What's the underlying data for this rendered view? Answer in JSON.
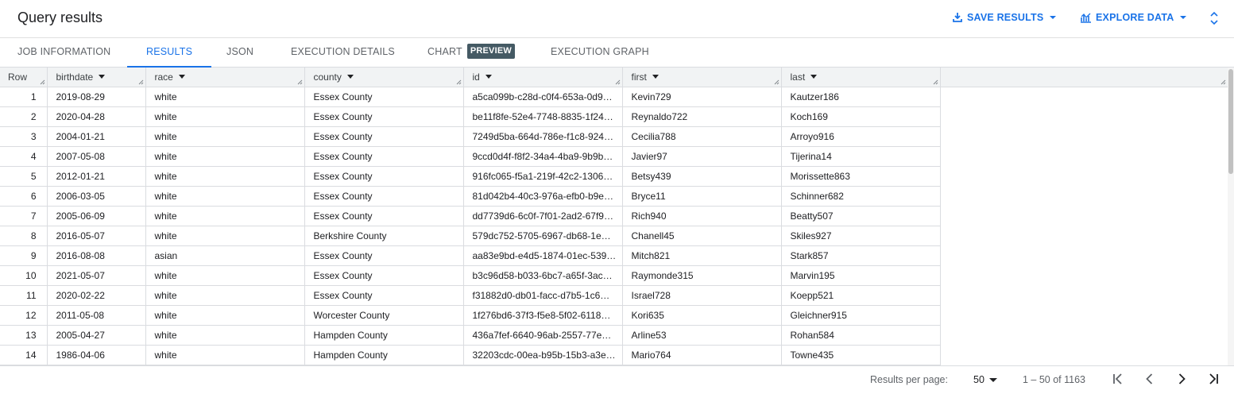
{
  "header": {
    "title": "Query results",
    "save_label": "SAVE RESULTS",
    "explore_label": "EXPLORE DATA"
  },
  "tabs": [
    {
      "label": "JOB INFORMATION"
    },
    {
      "label": "RESULTS"
    },
    {
      "label": "JSON"
    },
    {
      "label": "EXECUTION DETAILS"
    },
    {
      "label": "CHART",
      "badge": "PREVIEW"
    },
    {
      "label": "EXECUTION GRAPH"
    }
  ],
  "active_tab": "RESULTS",
  "table": {
    "row_header": "Row",
    "columns": [
      "birthdate",
      "race",
      "county",
      "id",
      "first",
      "last"
    ],
    "rows": [
      [
        "1",
        "2019-08-29",
        "white",
        "Essex County",
        "a5ca099b-c28d-c0f4-653a-0d9…",
        "Kevin729",
        "Kautzer186"
      ],
      [
        "2",
        "2020-04-28",
        "white",
        "Essex County",
        "be11f8fe-52e4-7748-8835-1f24…",
        "Reynaldo722",
        "Koch169"
      ],
      [
        "3",
        "2004-01-21",
        "white",
        "Essex County",
        "7249d5ba-664d-786e-f1c8-924…",
        "Cecilia788",
        "Arroyo916"
      ],
      [
        "4",
        "2007-05-08",
        "white",
        "Essex County",
        "9ccd0d4f-f8f2-34a4-4ba9-9b9b…",
        "Javier97",
        "Tijerina14"
      ],
      [
        "5",
        "2012-01-21",
        "white",
        "Essex County",
        "916fc065-f5a1-219f-42c2-1306…",
        "Betsy439",
        "Morissette863"
      ],
      [
        "6",
        "2006-03-05",
        "white",
        "Essex County",
        "81d042b4-40c3-976a-efb0-b9e…",
        "Bryce11",
        "Schinner682"
      ],
      [
        "7",
        "2005-06-09",
        "white",
        "Essex County",
        "dd7739d6-6c0f-7f01-2ad2-67f9…",
        "Rich940",
        "Beatty507"
      ],
      [
        "8",
        "2016-05-07",
        "white",
        "Berkshire County",
        "579dc752-5705-6967-db68-1e…",
        "Chanell45",
        "Skiles927"
      ],
      [
        "9",
        "2016-08-08",
        "asian",
        "Essex County",
        "aa83e9bd-e4d5-1874-01ec-539…",
        "Mitch821",
        "Stark857"
      ],
      [
        "10",
        "2021-05-07",
        "white",
        "Essex County",
        "b3c96d58-b033-6bc7-a65f-3ac…",
        "Raymonde315",
        "Marvin195"
      ],
      [
        "11",
        "2020-02-22",
        "white",
        "Essex County",
        "f31882d0-db01-facc-d7b5-1c6…",
        "Israel728",
        "Koepp521"
      ],
      [
        "12",
        "2011-05-08",
        "white",
        "Worcester County",
        "1f276bd6-37f3-f5e8-5f02-6118…",
        "Kori635",
        "Gleichner915"
      ],
      [
        "13",
        "2005-04-27",
        "white",
        "Hampden County",
        "436a7fef-6640-96ab-2557-77e…",
        "Arline53",
        "Rohan584"
      ],
      [
        "14",
        "1986-04-06",
        "white",
        "Hampden County",
        "32203cdc-00ea-b95b-15b3-a3e…",
        "Mario764",
        "Towne435"
      ],
      [
        "15",
        "",
        "",
        "",
        "",
        "",
        ""
      ]
    ]
  },
  "footer": {
    "results_per_page_label": "Results per page:",
    "results_per_page_value": "50",
    "range_text": "1 – 50 of 1163"
  },
  "colors": {
    "accent": "#1a73e8",
    "header_bg": "#f1f3f4",
    "grid_line": "#dadce0",
    "badge_bg": "#455a64"
  },
  "icons": [
    "download-icon",
    "chevron-down-icon",
    "chart-icon",
    "unfold-icon",
    "sort-icon",
    "resize-grip-icon",
    "first-page-icon",
    "prev-page-icon",
    "next-page-icon",
    "last-page-icon"
  ]
}
